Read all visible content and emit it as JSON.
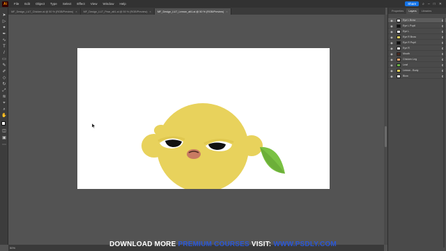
{
  "app": {
    "logo": "Ai"
  },
  "menu": [
    "File",
    "Edit",
    "Object",
    "Type",
    "Select",
    "Effect",
    "View",
    "Window",
    "Help"
  ],
  "toolbar_right": {
    "share_label": "Share"
  },
  "tabs": [
    {
      "label": "MF_Design_LU7_Chicken.ai @ 50 % (RGB/Preview)",
      "active": false
    },
    {
      "label": "MF_Design_LU7_Pear_alt1.ai @ 50 % (RGB/Preview)",
      "active": false
    },
    {
      "label": "MF_Design_LU7_Lemon_alt1.ai @ 50 % (RGB/Preview)",
      "active": true
    }
  ],
  "panel": {
    "tabs": [
      "Properties",
      "Layers",
      "Libraries"
    ],
    "layers": [
      {
        "name": "Eye L Brow",
        "color": "#ffffff"
      },
      {
        "name": "Eye L Pupil",
        "color": "#111111"
      },
      {
        "name": "Eye L",
        "color": "#ffffff"
      },
      {
        "name": "Eye R Brow",
        "color": "#e8d25c"
      },
      {
        "name": "Eye R Pupil",
        "color": "#111111"
      },
      {
        "name": "Eye R",
        "color": "#ffffff"
      },
      {
        "name": "Mouth",
        "color": "#4a2a20"
      },
      {
        "name": "Chicken Leg",
        "color": "#e7a36d"
      },
      {
        "name": "Leaf",
        "color": "#6bb547"
      },
      {
        "name": "Lemon - Body",
        "color": "#e8d25c"
      },
      {
        "name": "Blow",
        "color": "#ffffff"
      }
    ]
  },
  "status": {
    "zoom": "50%"
  },
  "artwork": {
    "lemon_color": "#e8d25c",
    "leaf_color": "#7ac143",
    "leaf_dark": "#5a9a2f",
    "mouth_color": "#c97b62"
  },
  "watermark": {
    "part1": "DOWNLOAD MORE ",
    "part2": "PREMIUM COURSES",
    "part3": " VISIT: ",
    "part4": "WWW.PSDLY.COM"
  }
}
